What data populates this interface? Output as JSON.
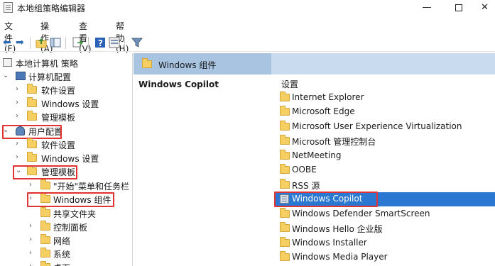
{
  "window": {
    "title": "本地组策略编辑器",
    "minimize_glyph": "—",
    "close_glyph": "✕"
  },
  "menu": [
    "文件(F)",
    "操作(A)",
    "查看(V)",
    "帮助(H)"
  ],
  "toolbar": {
    "icons": [
      "back-arrow-icon",
      "forward-arrow-icon",
      "up-folder-icon",
      "show-hide-tree-icon",
      "export-list-icon",
      "help-icon",
      "properties-icon",
      "filter-icon"
    ],
    "back_glyph": "⬅",
    "forward_glyph": "➡"
  },
  "tree": {
    "root": "本地计算机 策略",
    "computer_config": "计算机配置",
    "computer_children": [
      "软件设置",
      "Windows 设置",
      "管理模板"
    ],
    "user_config": "用户配置",
    "user_children": [
      "软件设置",
      "Windows 设置"
    ],
    "admin_templates": "管理模板",
    "admin_children": [
      "\"开始\"菜单和任务栏",
      "Windows 组件",
      "共享文件夹",
      "控制面板",
      "网络",
      "系统",
      "桌面"
    ]
  },
  "right_pane": {
    "header_title": "Windows 组件",
    "description_title": "Windows Copilot",
    "column_header": "设置",
    "items": [
      "Internet Explorer",
      "Microsoft Edge",
      "Microsoft User Experience Virtualization",
      "Microsoft 管理控制台",
      "NetMeeting",
      "OOBE",
      "RSS 源",
      "Windows Copilot",
      "Windows Defender SmartScreen",
      "Windows Hello 企业版",
      "Windows Installer",
      "Windows Media Player"
    ],
    "selected_item": "Windows Copilot"
  },
  "colors": {
    "highlight_box": "#e03434",
    "selection": "#2a78d2",
    "header_band": "#c9dcef",
    "folder": "#f6cf62"
  }
}
